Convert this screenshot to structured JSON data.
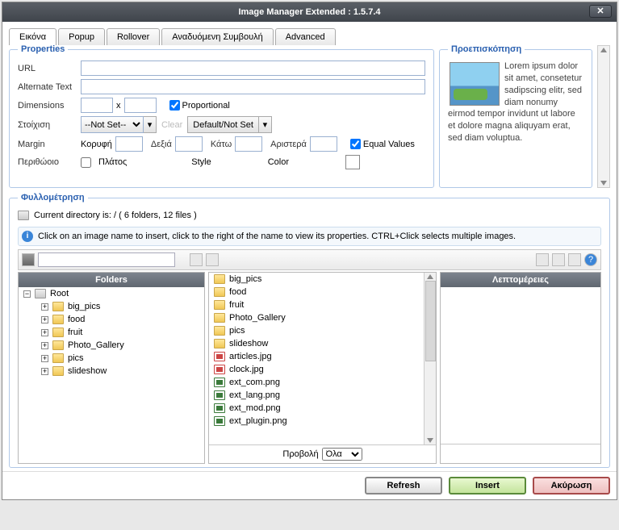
{
  "title": "Image Manager Extended : 1.5.7.4",
  "tabs": [
    "Εικόνα",
    "Popup",
    "Rollover",
    "Αναδυόμενη Συμβουλή",
    "Advanced"
  ],
  "properties": {
    "legend": "Properties",
    "url_label": "URL",
    "alt_label": "Alternate Text",
    "dim_label": "Dimensions",
    "dim_sep": "x",
    "proportional": "Proportional",
    "align_label": "Στοίχιση",
    "notset": "--Not Set--",
    "clear": "Clear",
    "default": "Default/Not Set",
    "margin_label": "Margin",
    "m_top": "Κορυφή",
    "m_right": "Δεξιά",
    "m_bottom": "Κάτω",
    "m_left": "Αριστερά",
    "equal": "Equal Values",
    "border_label": "Περιθώοιο",
    "width": "Πλάτος",
    "style": "Style",
    "color": "Color"
  },
  "preview": {
    "legend": "Προεπισκόπηση",
    "text": "Lorem ipsum dolor sit amet, consetetur sadipscing elitr, sed diam nonumy eirmod tempor invidunt ut labore et dolore magna aliquyam erat, sed diam voluptua."
  },
  "browser": {
    "legend": "Φυλλομέτρηση",
    "curdir": "Current directory is: / ( 6 folders, 12 files )",
    "hint": "Click on an image name to insert, click to the right of the name to view its properties. CTRL+Click selects multiple images.",
    "folders_head": "Folders",
    "details_head": "Λεπτομέρειες",
    "root": "Root",
    "tree": [
      "big_pics",
      "food",
      "fruit",
      "Photo_Gallery",
      "pics",
      "slideshow"
    ],
    "files_folders": [
      "big_pics",
      "food",
      "fruit",
      "Photo_Gallery",
      "pics",
      "slideshow"
    ],
    "files_images": [
      {
        "n": "articles.jpg",
        "t": "jpg"
      },
      {
        "n": "clock.jpg",
        "t": "jpg"
      },
      {
        "n": "ext_com.png",
        "t": "png"
      },
      {
        "n": "ext_lang.png",
        "t": "png"
      },
      {
        "n": "ext_mod.png",
        "t": "png"
      },
      {
        "n": "ext_plugin.png",
        "t": "png"
      }
    ],
    "view_label": "Προβολή",
    "view_sel": "Όλα"
  },
  "buttons": {
    "refresh": "Refresh",
    "insert": "Insert",
    "cancel": "Ακύρωση"
  }
}
